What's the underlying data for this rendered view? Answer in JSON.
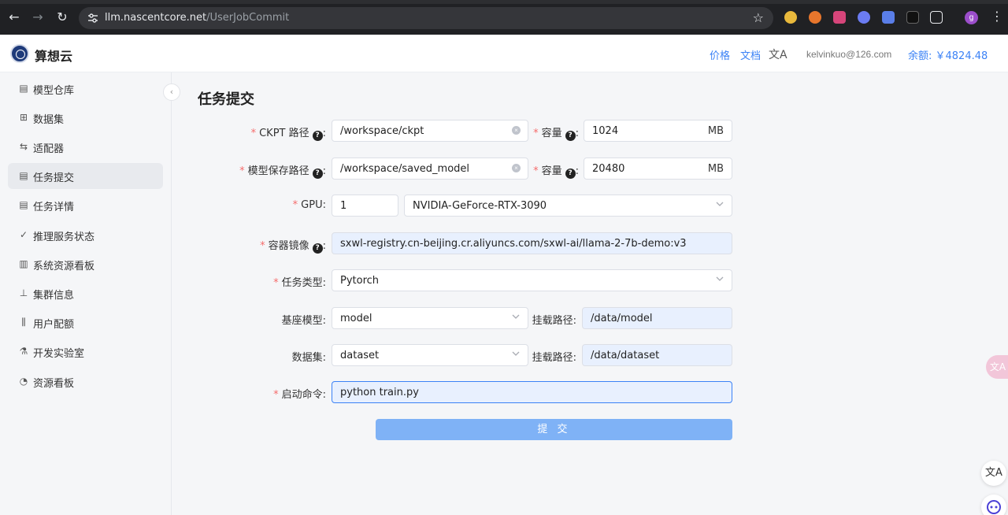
{
  "browser": {
    "url_host": "llm.nascentcore.net",
    "url_path": "/UserJobCommit",
    "profile_initial": "g"
  },
  "header": {
    "brand": "算想云",
    "price_link": "价格",
    "docs_link": "文档",
    "email": "kelvinkuo@126.com",
    "balance": "余额: ￥4824.48"
  },
  "sidebar": {
    "items": [
      {
        "label": "模型仓库",
        "icon": "doc-icon"
      },
      {
        "label": "数据集",
        "icon": "table-icon"
      },
      {
        "label": "适配器",
        "icon": "swap-icon"
      },
      {
        "label": "任务提交",
        "icon": "list-icon",
        "active": true
      },
      {
        "label": "任务详情",
        "icon": "detail-icon"
      },
      {
        "label": "推理服务状态",
        "icon": "check-circle-icon"
      },
      {
        "label": "系统资源看板",
        "icon": "bar-chart-icon"
      },
      {
        "label": "集群信息",
        "icon": "cluster-icon"
      },
      {
        "label": "用户配额",
        "icon": "quota-icon"
      },
      {
        "label": "开发实验室",
        "icon": "flask-icon"
      },
      {
        "label": "资源看板",
        "icon": "gauge-icon"
      }
    ]
  },
  "main": {
    "title": "任务提交",
    "form": {
      "ckpt_label": "CKPT 路径",
      "ckpt_value": "/workspace/ckpt",
      "ckpt_capacity_label": "容量",
      "ckpt_capacity_value": "1024",
      "unit": "MB",
      "model_save_label": "模型保存路径",
      "model_save_value": "/workspace/saved_model",
      "model_capacity_label": "容量",
      "model_capacity_value": "20480",
      "gpu_label": "GPU",
      "gpu_count": "1",
      "gpu_type": "NVIDIA-GeForce-RTX-3090",
      "image_label": "容器镜像",
      "image_value": "sxwl-registry.cn-beijing.cr.aliyuncs.com/sxwl-ai/llama-2-7b-demo:v3",
      "task_type_label": "任务类型",
      "task_type_value": "Pytorch",
      "base_model_label": "基座模型",
      "base_model_value": "model",
      "mount_path_label": "挂载路径",
      "base_model_mount": "/data/model",
      "dataset_label": "数据集",
      "dataset_value": "dataset",
      "dataset_mount": "/data/dataset",
      "command_label": "启动命令",
      "command_value": "python train.py",
      "submit": "提 交"
    }
  },
  "floating": {
    "translate_tab": "文A",
    "translate_btn": "文A"
  }
}
